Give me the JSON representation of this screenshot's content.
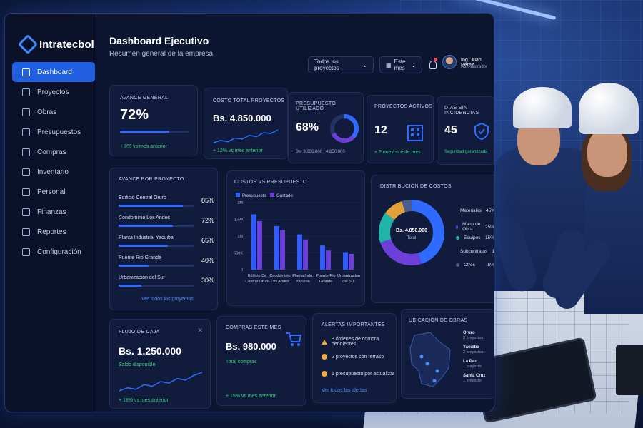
{
  "brand": {
    "name": "Intratecbol"
  },
  "sidebar": {
    "items": [
      {
        "label": "Dashboard",
        "active": true,
        "icon": "home-icon"
      },
      {
        "label": "Proyectos",
        "icon": "folder-icon"
      },
      {
        "label": "Obras",
        "icon": "building-icon"
      },
      {
        "label": "Presupuestos",
        "icon": "document-icon"
      },
      {
        "label": "Compras",
        "icon": "cart-icon"
      },
      {
        "label": "Inventario",
        "icon": "box-icon"
      },
      {
        "label": "Personal",
        "icon": "user-icon"
      },
      {
        "label": "Finanzas",
        "icon": "dollar-icon"
      },
      {
        "label": "Reportes",
        "icon": "report-icon"
      },
      {
        "label": "Configuración",
        "icon": "gear-icon"
      }
    ]
  },
  "header": {
    "title": "Dashboard Ejecutivo",
    "subtitle": "Resumen general de la empresa",
    "project_filter": "Todos los proyectos",
    "period_filter": "Este mes",
    "user_name": "Ing. Juan Perez",
    "user_role": "Administrador"
  },
  "kpis": {
    "avance": {
      "label": "Avance general",
      "value": "72%",
      "progress": 0.72,
      "delta": "+ 8% vs mes anterior"
    },
    "costo": {
      "label": "Costo total proyectos",
      "value": "Bs. 4.850.000",
      "delta": "+ 12% vs mes anterior"
    },
    "presupuesto": {
      "label": "Presupuesto utilizado",
      "value": "68%",
      "fraction": 0.68,
      "detail": "Bs. 3.298.000 / 4.850.000"
    },
    "activos": {
      "label": "Proyectos activos",
      "value": "12",
      "delta": "+ 2 nuevos este mes"
    },
    "incidencias": {
      "label": "Días sin incidencias",
      "value": "45",
      "note": "Seguridad garantizada"
    }
  },
  "avance_proyecto": {
    "title": "Avance por proyecto",
    "rows": [
      {
        "name": "Edificio Central Oruro",
        "pct": "85%",
        "value": 0.85
      },
      {
        "name": "Condominio Los Andes",
        "pct": "72%",
        "value": 0.72
      },
      {
        "name": "Planta Industrial Yacuiba",
        "pct": "65%",
        "value": 0.65
      },
      {
        "name": "Puente Rio Grande",
        "pct": "40%",
        "value": 0.4
      },
      {
        "name": "Urbanización del Sur",
        "pct": "30%",
        "value": 0.3
      }
    ],
    "link": "Ver todos los proyectos"
  },
  "chart_data": [
    {
      "type": "bar",
      "title": "Costos vs Presupuesto",
      "categories": [
        "Edificio Cе Central Oruro",
        "Condominio Los Andes",
        "Planta Indu. Yacuiba",
        "Puente Rio Grande",
        "Urbanización del Sur"
      ],
      "category_lines": [
        [
          "Edificio Ce",
          "Central Oruro"
        ],
        [
          "Condominio",
          "Los Andes"
        ],
        [
          "Planta Indu.",
          "Yacuiba"
        ],
        [
          "Puente Rio",
          "Grande"
        ],
        [
          "Urbanización",
          "del Sur"
        ]
      ],
      "series": [
        {
          "name": "Presupuesto",
          "color": "#2f5bff",
          "values": [
            1.65,
            1.3,
            1.05,
            0.72,
            0.52
          ]
        },
        {
          "name": "Gastado",
          "color": "#6b3fd8",
          "values": [
            1.45,
            1.18,
            0.9,
            0.57,
            0.47
          ]
        }
      ],
      "ylabel_ticks": [
        "0",
        "500K",
        "1M",
        "1.5M",
        "2M"
      ],
      "ylim": [
        0,
        2
      ],
      "grid": true,
      "legend": "top-left"
    },
    {
      "type": "pie",
      "title": "Distribución de costos",
      "center_value": "Bs. 4.850.000",
      "center_label": "Total",
      "slices": [
        {
          "name": "Materiales",
          "value": 45,
          "label": "45%",
          "color": "#2f6bff"
        },
        {
          "name": "Mano de Obra",
          "value": 25,
          "label": "25%",
          "color": "#6b3fd8"
        },
        {
          "name": "Equipos",
          "value": 15,
          "label": "15%",
          "color": "#1fb5a8"
        },
        {
          "name": "Subcontratos",
          "value": 10,
          "label": "10%",
          "color": "#e0a13a"
        },
        {
          "name": "Otros",
          "value": 5,
          "label": "5%",
          "color": "#4a5d8f"
        }
      ]
    }
  ],
  "flujo": {
    "label": "Flujo de caja",
    "value": "Bs. 1.250.000",
    "note": "Saldo disponible",
    "delta": "+ 18% vs mes anterior",
    "trend": [
      2,
      3,
      2.5,
      4,
      3.5,
      5,
      4.5,
      6,
      5.5,
      7,
      8
    ]
  },
  "compras": {
    "label": "Compras este mes",
    "value": "Bs. 980.000",
    "note": "Total compras",
    "delta": "+ 15% vs mes anterior"
  },
  "costo_trend": [
    2,
    2.5,
    2.2,
    3,
    2.8,
    3.6,
    3.3,
    4.2,
    4.0,
    4.8
  ],
  "alertas": {
    "title": "Alertas importantes",
    "items": [
      {
        "text": "3 órdenes de compra pendientes",
        "icon": "warning-icon"
      },
      {
        "text": "2 proyectos con retraso",
        "icon": "clock-icon"
      },
      {
        "text": "1 presupuesto por actualizar",
        "icon": "info-icon"
      }
    ],
    "link": "Ver todas las alertas"
  },
  "ubicacion": {
    "title": "Ubicación de obras",
    "cities": [
      {
        "name": "Oruro",
        "count": "3 proyectos"
      },
      {
        "name": "Yacuiba",
        "count": "2 proyectos"
      },
      {
        "name": "La Paz",
        "count": "1 proyecto"
      },
      {
        "name": "Santa Cruz",
        "count": "1 proyecto"
      }
    ]
  },
  "colors": {
    "accent": "#1f5fe0",
    "positive": "#35d07f",
    "background": "#0d1630"
  }
}
